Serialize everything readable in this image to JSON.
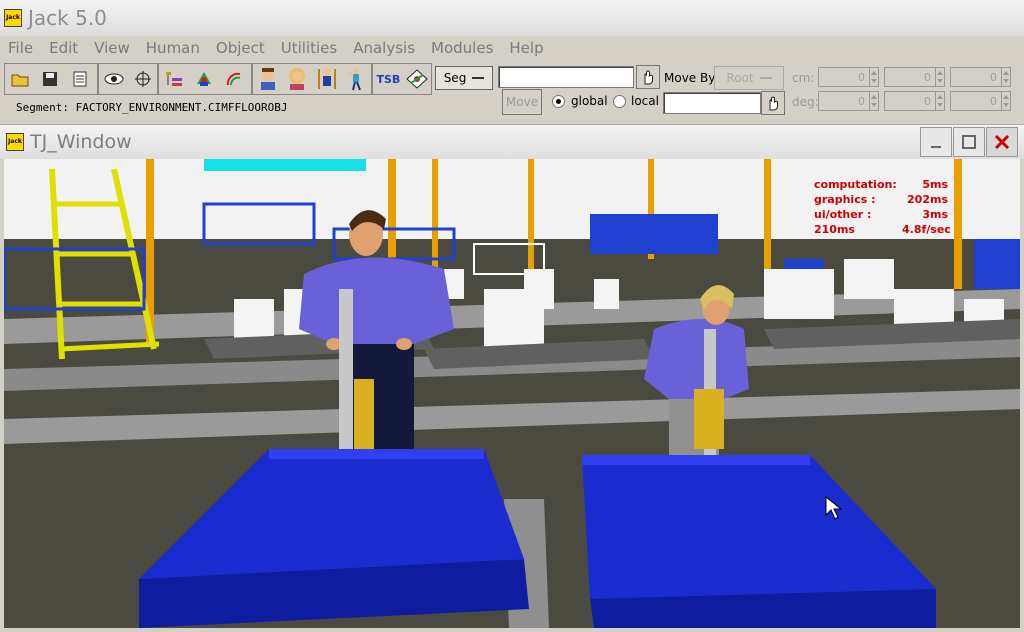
{
  "app": {
    "title": "Jack 5.0",
    "logo_text": "Jack"
  },
  "menu": [
    "File",
    "Edit",
    "View",
    "Human",
    "Object",
    "Utilities",
    "Analysis",
    "Modules",
    "Help"
  ],
  "toolbar": {
    "icons": [
      "open-folder-icon",
      "save-icon",
      "document-icon",
      "eye-icon",
      "move-cross-icon",
      "hierarchy-icon",
      "figure-tools-icon",
      "arc-icon",
      "male-human-icon",
      "female-human-icon",
      "figure-scale-icon",
      "figure-pose-icon",
      "tsb-icon",
      "constraint-icon"
    ],
    "tsb_label": "TSB",
    "seg_label": "Seg",
    "move_by_label": "Move By:",
    "root_label": "Root",
    "move_label": "Move",
    "global_label": "global",
    "local_label": "local",
    "cm_label": "cm:",
    "deg_label": "deg:",
    "cm_values": [
      "0",
      "0",
      "0"
    ],
    "deg_values": [
      "0",
      "0",
      "0"
    ]
  },
  "segment_text": "Segment: FACTORY_ENVIRONMENT.CIMFFLOOROBJ",
  "window": {
    "title": "TJ_Window",
    "logo_text": "Jack"
  },
  "perf": [
    {
      "k": "computation:",
      "v": "5ms"
    },
    {
      "k": "graphics  :",
      "v": "202ms"
    },
    {
      "k": "ui/other  :",
      "v": "3ms"
    },
    {
      "k": "   210ms",
      "v": "4.8f/sec"
    }
  ],
  "colors": {
    "bin_blue": "#1a2bd0",
    "shirt": "#6a60d8",
    "column": "#e8a000",
    "perf_red": "#d00000"
  }
}
